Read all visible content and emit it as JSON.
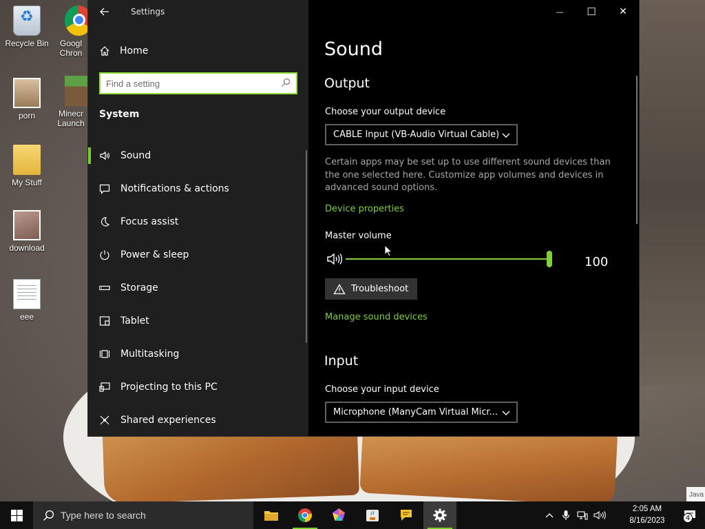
{
  "desktop": {
    "icons": [
      {
        "label": "Recycle Bin",
        "icon": "recycle-bin-icon"
      },
      {
        "label": "Googl Chron",
        "icon": "chrome-icon"
      },
      {
        "label": "porn",
        "icon": "image-file-icon"
      },
      {
        "label": "Minecr Launch",
        "icon": "minecraft-icon"
      },
      {
        "label": "My Stuff",
        "icon": "folder-icon"
      },
      {
        "label": "download",
        "icon": "image-file-icon"
      },
      {
        "label": "eee",
        "icon": "text-file-icon"
      }
    ],
    "java_tip": "Java"
  },
  "window": {
    "title": "Settings",
    "controls": {
      "minimize": "—",
      "maximize": "☐",
      "close": "✕"
    },
    "sidebar": {
      "home_label": "Home",
      "search_placeholder": "Find a setting",
      "section_title": "System",
      "items": [
        {
          "label": "Sound",
          "icon": "speaker-icon",
          "active": true
        },
        {
          "label": "Notifications & actions",
          "icon": "message-icon"
        },
        {
          "label": "Focus assist",
          "icon": "moon-icon"
        },
        {
          "label": "Power & sleep",
          "icon": "power-icon"
        },
        {
          "label": "Storage",
          "icon": "storage-icon"
        },
        {
          "label": "Tablet",
          "icon": "tablet-icon"
        },
        {
          "label": "Multitasking",
          "icon": "multitasking-icon"
        },
        {
          "label": "Projecting to this PC",
          "icon": "projecting-icon"
        },
        {
          "label": "Shared experiences",
          "icon": "shared-icon"
        }
      ]
    },
    "content": {
      "page_title": "Sound",
      "output": {
        "heading": "Output",
        "device_label": "Choose your output device",
        "device_value": "CABLE Input (VB-Audio Virtual Cable)",
        "description": "Certain apps may be set up to use different sound devices than the one selected here. Customize app volumes and devices in advanced sound options.",
        "device_properties_link": "Device properties",
        "master_volume_label": "Master volume",
        "volume": 100,
        "troubleshoot_label": "Troubleshoot",
        "manage_link": "Manage sound devices"
      },
      "input": {
        "heading": "Input",
        "device_label": "Choose your input device",
        "device_value": "Microphone (ManyCam Virtual Micr..."
      }
    }
  },
  "taskbar": {
    "search_placeholder": "Type here to search",
    "apps": [
      {
        "name": "File Explorer",
        "icon": "folder-icon"
      },
      {
        "name": "Google Chrome",
        "icon": "chrome-icon"
      },
      {
        "name": "Paint 3D",
        "icon": "paint-icon"
      },
      {
        "name": "Java",
        "icon": "java-icon"
      },
      {
        "name": "Messenger",
        "icon": "chat-icon"
      },
      {
        "name": "Settings",
        "icon": "gear-icon"
      }
    ],
    "time": "2:05 AM",
    "date": "8/16/2023",
    "notification_count": "4"
  },
  "colors": {
    "accent": "#74d326",
    "link": "#7fd03a",
    "sidebar_bg": "#1f1f1f",
    "content_bg": "#000000",
    "taskbar_bg": "#101010"
  }
}
